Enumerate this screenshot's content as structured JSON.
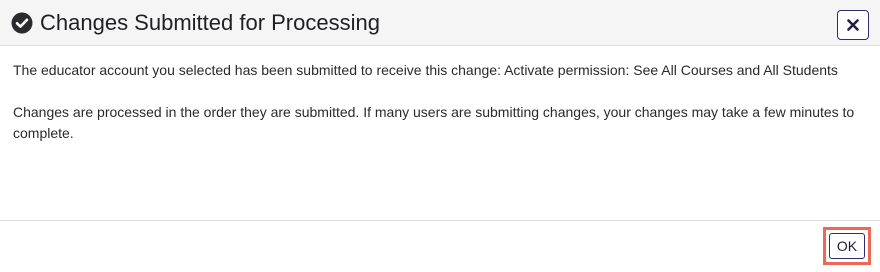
{
  "dialog": {
    "title": "Changes Submitted for Processing",
    "title_icon": "check-circle-icon",
    "close_icon": "close-icon",
    "paragraphs": [
      "The educator account you selected has been submitted to receive this change: Activate permission: See All Courses and All Students",
      "Changes are processed in the order they are submitted. If many users are submitting changes, your changes may take a few minutes to complete."
    ],
    "ok_label": "OK"
  },
  "colors": {
    "header_bg": "#f5f5f6",
    "button_border": "#2c2c6e",
    "highlight": "#ec6a55",
    "text": "#2a2a2e"
  }
}
